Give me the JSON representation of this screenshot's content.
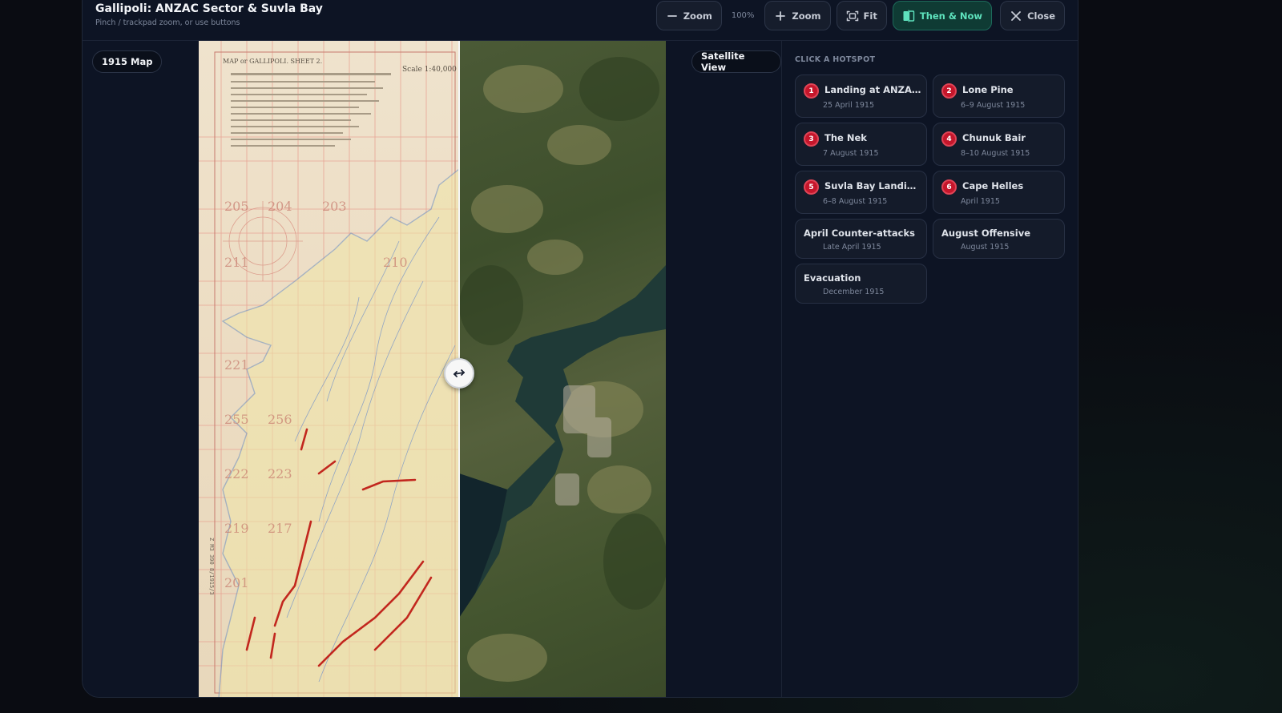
{
  "header": {
    "title": "Gallipoli: ANZAC Sector & Suvla Bay",
    "subtitle": "Pinch / trackpad zoom, or use buttons"
  },
  "toolbar": {
    "zoom_out_label": "Zoom",
    "zoom_level": "100%",
    "zoom_in_label": "Zoom",
    "fit_label": "Fit",
    "then_now_label": "Then & Now",
    "close_label": "Close"
  },
  "viewer": {
    "left_label": "1915 Map",
    "right_label": "Satellite View",
    "old_map_title": "MAP or GALLIPOLI. SHEET 2.",
    "old_map_scale": "Scale 1:40,000",
    "old_map_grid_numbers": [
      "205",
      "204",
      "203",
      "211",
      "210",
      "221",
      "256",
      "255",
      "222",
      "223",
      "219",
      "217",
      "201"
    ],
    "old_map_ref": "Z M3 390 8/1915/3"
  },
  "hotspots": {
    "heading": "CLICK A HOTSPOT",
    "items": [
      {
        "num": "1",
        "title": "Landing at ANZAC C...",
        "date": "25 April 1915"
      },
      {
        "num": "2",
        "title": "Lone Pine",
        "date": "6–9 August 1915"
      },
      {
        "num": "3",
        "title": "The Nek",
        "date": "7 August 1915"
      },
      {
        "num": "4",
        "title": "Chunuk Bair",
        "date": "8–10 August 1915"
      },
      {
        "num": "5",
        "title": "Suvla Bay Landings",
        "date": "6–8 August 1915"
      },
      {
        "num": "6",
        "title": "Cape Helles",
        "date": "April 1915"
      },
      {
        "num": "",
        "title": "April Counter-attacks",
        "date": "Late April 1915"
      },
      {
        "num": "",
        "title": "August Offensive",
        "date": "August 1915"
      },
      {
        "num": "",
        "title": "Evacuation",
        "date": "December 1915"
      }
    ]
  },
  "colors": {
    "accent": "#5ee2bd",
    "hotspot_marker": "#c5162b",
    "panel_bg": "#0d1424"
  }
}
